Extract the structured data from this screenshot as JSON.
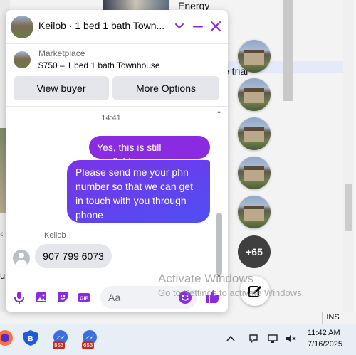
{
  "background": {
    "top_label": "Energy",
    "mid_label": "e triai",
    "status_mode": "INS"
  },
  "chat": {
    "header_title": "Keilob · 1 bed 1 bath Town...",
    "marketplace_label": "Marketplace",
    "listing": "$750 – 1 bed 1 bath Townhouse",
    "view_buyer_label": "View buyer",
    "more_options_label": "More Options",
    "timestamp": "14:41",
    "messages_out": [
      "Yes, this is still available",
      "Please send me your phn number so that we can get in touch with you through phone"
    ],
    "sender_name": "Keilob",
    "message_in": "907 799 6073",
    "input_placeholder": "Aa",
    "accent_color": "#8a2be2",
    "icons": [
      "microphone-icon",
      "photo-icon",
      "sticker-icon",
      "gif-icon",
      "emoji-icon",
      "like-icon"
    ]
  },
  "chat_heads": {
    "more_count": "+65"
  },
  "watermark": {
    "title": "Activate Windows",
    "subtitle": "Go to Settings to activate Windows."
  },
  "taskbar": {
    "badges": [
      "853",
      "653"
    ],
    "time": "11:42 AM",
    "date": "7/16/2025"
  }
}
